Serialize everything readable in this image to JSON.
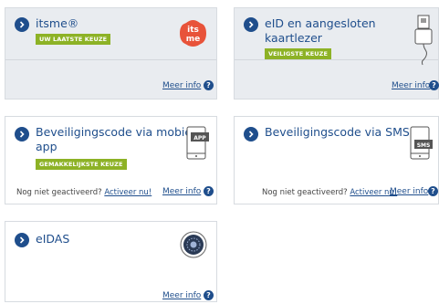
{
  "cards": {
    "itsme": {
      "title": "itsme®",
      "badge": "UW LAATSTE KEUZE",
      "meer_info": "Meer info",
      "logo_text_top": "its",
      "logo_text_bottom": "me",
      "logo_color": "#e8533a"
    },
    "eid": {
      "title_line1": "eID en aangesloten",
      "title_line2": "kaartlezer",
      "badge": "VEILIGSTE KEUZE",
      "meer_info": "Meer info"
    },
    "app": {
      "title_line1": "Beveiligingscode via mobiele",
      "title_line2": "app",
      "badge": "GEMAKKELIJKSTE KEUZE",
      "nog": "Nog niet geactiveerd?",
      "activeer": "Activeer nu!",
      "meer_info": "Meer info",
      "device_label": "APP"
    },
    "sms": {
      "title": "Beveiligingscode via SMS",
      "nog": "Nog niet geactiveerd?",
      "activeer": "Activeer nu!",
      "meer_info": "Meer info",
      "device_label": "SMS"
    },
    "eidas": {
      "title": "eIDAS",
      "meer_info": "Meer info"
    }
  },
  "colors": {
    "brand_blue": "#1f4e8c",
    "badge_green": "#8db226",
    "grey_card": "#e9ecf0"
  }
}
